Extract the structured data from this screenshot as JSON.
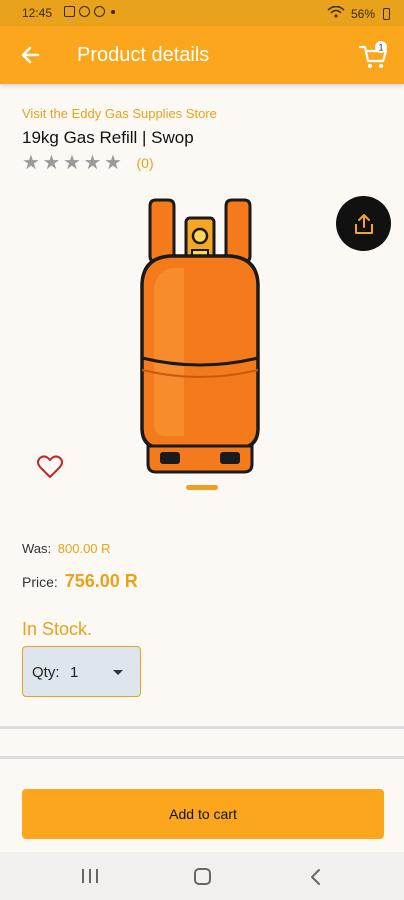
{
  "status_bar": {
    "time": "12:45",
    "battery": "56%"
  },
  "app_bar": {
    "title": "Product details",
    "cart_count": "1"
  },
  "product": {
    "store_link": "Visit the Eddy Gas Supplies Store",
    "title": "19kg Gas Refill | Swop",
    "rating_count": "(0)",
    "was_label": "Was:",
    "was_price": "800.00 R",
    "price_label": "Price:",
    "price": "756.00 R",
    "stock": "In Stock.",
    "qty_label": "Qty:",
    "qty_value": "1",
    "image_icon": "gas-cylinder"
  },
  "actions": {
    "add_to_cart": "Add to cart"
  },
  "colors": {
    "brand": "#fba61d",
    "accent_text": "#e8a21c",
    "background": "#fcf9f4",
    "qty_bg": "#dce6ec"
  },
  "icons": [
    "back-arrow-icon",
    "cart-icon",
    "share-icon",
    "heart-icon",
    "star-icon"
  ]
}
